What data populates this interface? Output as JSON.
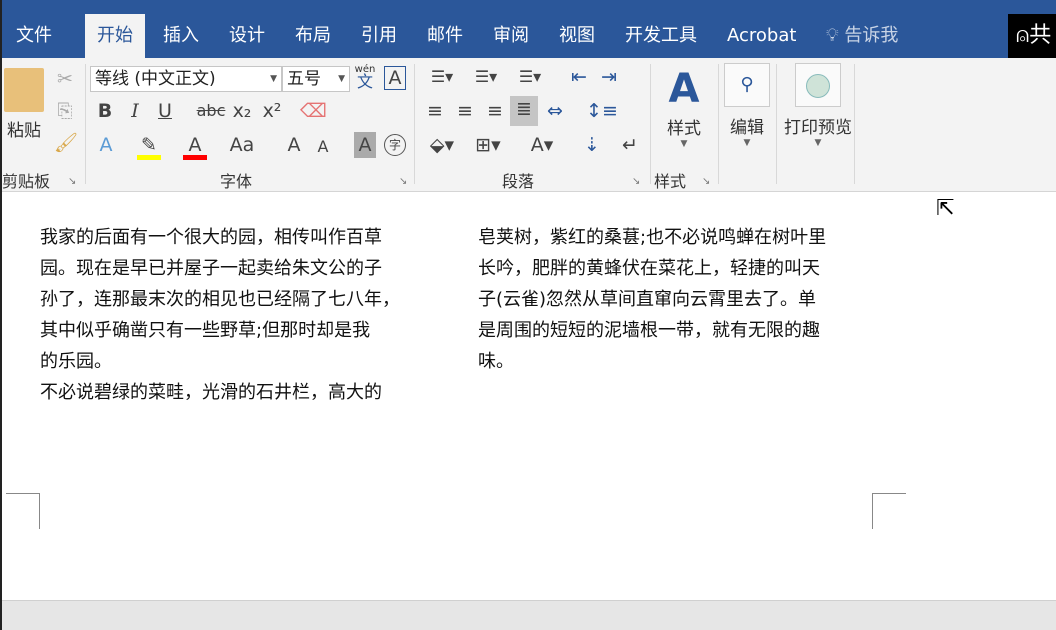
{
  "tabs": [
    "文件",
    "开始",
    "插入",
    "设计",
    "布局",
    "引用",
    "邮件",
    "审阅",
    "视图",
    "开发工具",
    "Acrobat"
  ],
  "active_tab": "开始",
  "tell_me": "告诉我",
  "share_label": "共",
  "ribbon": {
    "clipboard": {
      "paste": "粘贴",
      "label": "剪贴板"
    },
    "font": {
      "font_name": "等线 (中文正文)",
      "font_size": "五号",
      "label": "字体",
      "phonetic_top": "wén",
      "phonetic_char": "文",
      "bold": "B",
      "italic": "I",
      "underline": "U",
      "strike": "abc",
      "sub": "x₂",
      "sup": "x²",
      "change_case": "Aa",
      "grow": "A",
      "shrink": "A",
      "enclose": "字",
      "highlight_color": "#ffff00",
      "font_color": "#ff0000"
    },
    "paragraph": {
      "label": "段落"
    },
    "styles": {
      "button": "样式",
      "label": "样式"
    },
    "editing": {
      "button": "编辑"
    },
    "print_preview": {
      "button": "打印预览"
    }
  },
  "document": {
    "col1": [
      "我家的后面有一个很大的园，相传叫作百草",
      "园。现在是早已并屋子一起卖给朱文公的子",
      "孙了，连那最末次的相见也已经隔了七八年，",
      "其中似乎确凿只有一些野草;但那时却是我",
      "的乐园。",
      "不必说碧绿的菜畦，光滑的石井栏，高大的"
    ],
    "col2": [
      "皂荚树，紫红的桑葚;也不必说鸣蝉在树叶里",
      "长吟，肥胖的黄蜂伏在菜花上，轻捷的叫天",
      "子(云雀)忽然从草间直窜向云霄里去了。单",
      "是周围的短短的泥墙根一带，就有无限的趣",
      "味。"
    ]
  }
}
